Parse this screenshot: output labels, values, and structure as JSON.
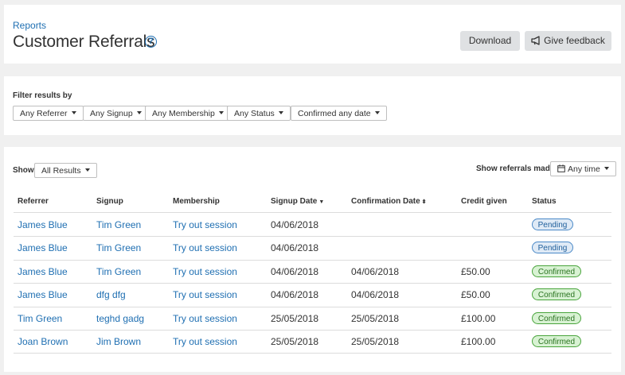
{
  "header": {
    "breadcrumb": "Reports",
    "title": "Customer Referrals",
    "help_icon_glyph": "?",
    "download_label": "Download",
    "feedback_label": "Give feedback"
  },
  "filters": {
    "label": "Filter results by",
    "dropdowns": [
      "Any Referrer",
      "Any Signup",
      "Any Membership",
      "Any Status",
      "Confirmed any date"
    ]
  },
  "results": {
    "show_label": "Show",
    "show_value": "All Results",
    "made_label": "Show referrals made",
    "made_value": "Any time",
    "columns": [
      "Referrer",
      "Signup",
      "Membership",
      "Signup Date",
      "Confirmation Date",
      "Credit given",
      "Status"
    ],
    "rows": [
      {
        "referrer": "James Blue",
        "signup": "Tim Green",
        "membership": "Try out session",
        "signup_date": "04/06/2018",
        "confirmation_date": "",
        "credit": "",
        "status": "Pending"
      },
      {
        "referrer": "James Blue",
        "signup": "Tim Green",
        "membership": "Try out session",
        "signup_date": "04/06/2018",
        "confirmation_date": "",
        "credit": "",
        "status": "Pending"
      },
      {
        "referrer": "James Blue",
        "signup": "Tim Green",
        "membership": "Try out session",
        "signup_date": "04/06/2018",
        "confirmation_date": "04/06/2018",
        "credit": "£50.00",
        "status": "Confirmed"
      },
      {
        "referrer": "James Blue",
        "signup": "dfg dfg",
        "membership": "Try out session",
        "signup_date": "04/06/2018",
        "confirmation_date": "04/06/2018",
        "credit": "£50.00",
        "status": "Confirmed"
      },
      {
        "referrer": "Tim Green",
        "signup": "teghd gadg",
        "membership": "Try out session",
        "signup_date": "25/05/2018",
        "confirmation_date": "25/05/2018",
        "credit": "£100.00",
        "status": "Confirmed"
      },
      {
        "referrer": "Joan Brown",
        "signup": "Jim Brown",
        "membership": "Try out session",
        "signup_date": "25/05/2018",
        "confirmation_date": "25/05/2018",
        "credit": "£100.00",
        "status": "Confirmed"
      }
    ]
  },
  "icons": {
    "help": "help-icon",
    "feedback": "megaphone-icon",
    "calendar": "calendar-icon",
    "caret": "chevron-down-icon",
    "sort_desc": "sort-down-icon",
    "sort_both": "sort-both-icon"
  },
  "colors": {
    "link": "#1f6fb2",
    "pending_bg": "#dfeaf6",
    "pending_border": "#4a89c7",
    "confirmed_bg": "#d8f2d3",
    "confirmed_border": "#48a43b",
    "button_grey": "#dfe1e3"
  }
}
